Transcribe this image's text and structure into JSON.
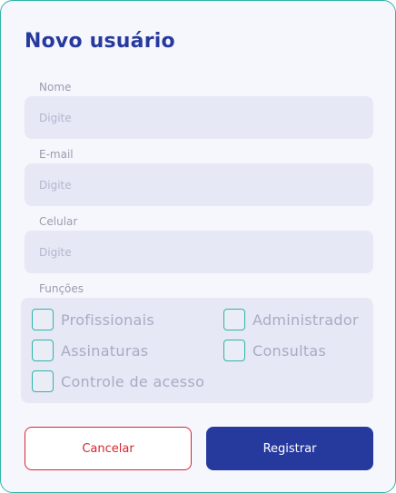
{
  "form": {
    "title": "Novo usuário",
    "fields": [
      {
        "label": "Nome",
        "placeholder": "Digite",
        "value": ""
      },
      {
        "label": "E-mail",
        "placeholder": "Digite",
        "value": ""
      },
      {
        "label": "Celular",
        "placeholder": "Digite",
        "value": ""
      }
    ],
    "roles": {
      "label": "Funções",
      "options": [
        {
          "label": "Profissionais",
          "checked": false
        },
        {
          "label": "Administrador",
          "checked": false
        },
        {
          "label": "Assinaturas",
          "checked": false
        },
        {
          "label": "Consultas",
          "checked": false
        },
        {
          "label": "Controle de acesso",
          "checked": false
        }
      ]
    },
    "buttons": {
      "cancel": "Cancelar",
      "submit": "Registrar"
    }
  },
  "colors": {
    "accent": "#263a9e",
    "border": "#2fb5a6",
    "danger": "#d8262e",
    "input_bg": "#e7e8f5"
  }
}
